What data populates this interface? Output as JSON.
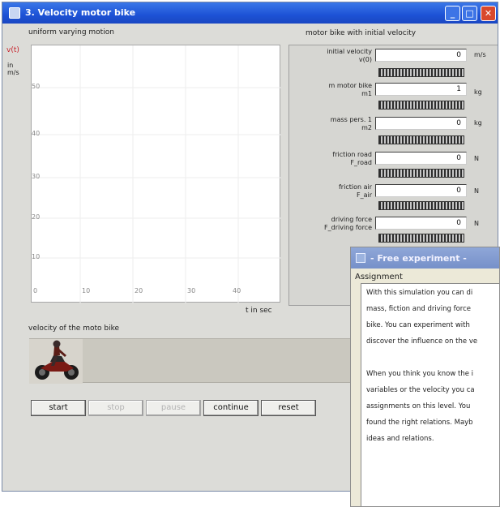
{
  "window": {
    "title": "3. Velocity motor bike"
  },
  "graph": {
    "heading": "uniform varying motion",
    "y_label": "v(t)",
    "y_unit": "in m/s",
    "y_ticks": [
      "50",
      "40",
      "30",
      "20",
      "10"
    ],
    "x_ticks": [
      "0",
      "10",
      "20",
      "30",
      "40"
    ],
    "x_label": "t  in sec"
  },
  "panel": {
    "heading": "motor bike with initial velocity",
    "params": [
      {
        "label1": "initial velocity",
        "label2": "v(0)",
        "value": "0",
        "unit": "m/s"
      },
      {
        "label1": "m motor bike",
        "label2": "m1",
        "value": "1",
        "unit": "kg"
      },
      {
        "label1": "mass pers. 1",
        "label2": "m2",
        "value": "0",
        "unit": "kg"
      },
      {
        "label1": "friction road",
        "label2": "F_road",
        "value": "0",
        "unit": "N"
      },
      {
        "label1": "friction air",
        "label2": "F_air",
        "value": "0",
        "unit": "N"
      },
      {
        "label1": "driving force",
        "label2": "F_driving force",
        "value": "0",
        "unit": "N"
      }
    ]
  },
  "track": {
    "heading": "velocity of the moto bike"
  },
  "buttons": {
    "start": "start",
    "stop": "stop",
    "pause": "pause",
    "continue": "continue",
    "reset": "reset"
  },
  "dialog": {
    "title": "- Free experiment -",
    "heading": "Assignment",
    "lines": [
      "With this simulation you can di",
      "mass, fiction and driving force",
      "bike. You can experiment with",
      "discover the influence on the ve",
      "",
      "When you think you know the i",
      "variables or the velocity you ca",
      "assignments on this level. You",
      "found the right relations. Mayb",
      "ideas and relations."
    ]
  }
}
